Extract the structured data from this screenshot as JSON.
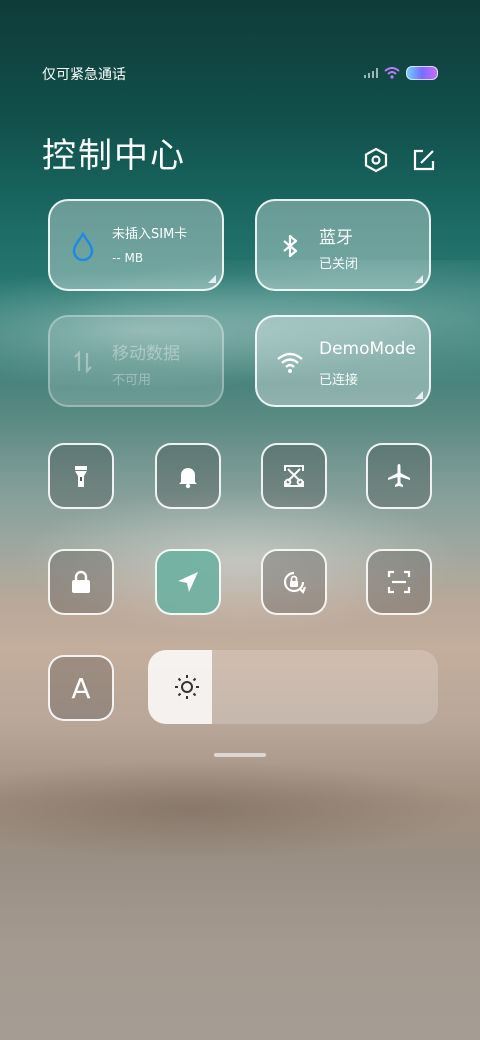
{
  "status_bar": {
    "carrier_text": "仅可紧急通话",
    "battery_color": "#7a6bff"
  },
  "control_center": {
    "title": "控制中心",
    "settings_icon": "hexagon-settings-icon",
    "edit_icon": "edit-icon"
  },
  "tiles": {
    "sim": {
      "title": "未插入SIM卡",
      "sub": "-- MB",
      "icon": "water-drop-icon",
      "icon_color": "#1e88e5"
    },
    "bluetooth": {
      "title": "蓝牙",
      "sub": "已关闭",
      "icon": "bluetooth-icon"
    },
    "mobile_data": {
      "title": "移动数据",
      "sub": "不可用",
      "icon": "data-arrows-icon"
    },
    "wifi": {
      "title": "DemoMode",
      "sub": "已连接",
      "icon": "wifi-icon"
    }
  },
  "toggles": [
    {
      "name": "flashlight",
      "icon": "flashlight-icon",
      "active": false
    },
    {
      "name": "silent",
      "icon": "bell-icon",
      "active": false
    },
    {
      "name": "screenshot",
      "icon": "scissors-icon",
      "active": false
    },
    {
      "name": "airplane",
      "icon": "airplane-icon",
      "active": false
    },
    {
      "name": "lock",
      "icon": "lock-icon",
      "active": false
    },
    {
      "name": "location",
      "icon": "location-arrow-icon",
      "active": true,
      "active_color": "#68b0a0"
    },
    {
      "name": "rotation-lock",
      "icon": "rotation-lock-icon",
      "active": false
    },
    {
      "name": "scanner",
      "icon": "scan-icon",
      "active": false
    },
    {
      "name": "auto-brightness",
      "icon": "letter-a-icon",
      "active": false,
      "label": "A"
    }
  ],
  "brightness": {
    "level": 0.22,
    "icon": "sun-icon"
  }
}
